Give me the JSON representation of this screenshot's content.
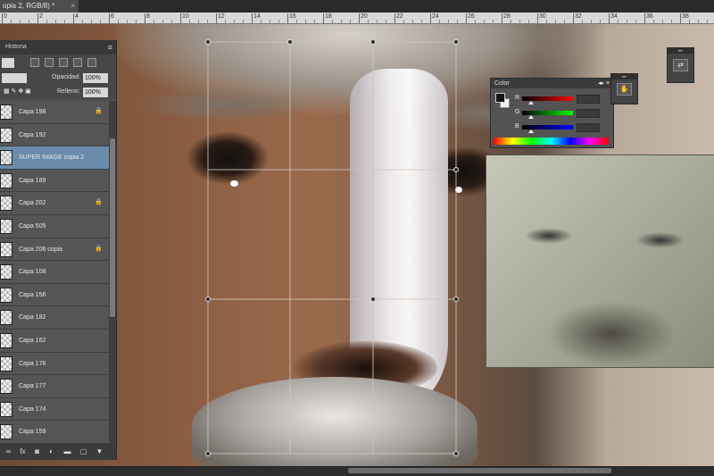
{
  "document_tab": {
    "label": "opia 2, RGB/8) *",
    "close": "×"
  },
  "ruler": {
    "labels": [
      "0",
      "2",
      "4",
      "6",
      "8",
      "10",
      "12",
      "14",
      "16",
      "18",
      "20",
      "22",
      "24",
      "26",
      "28",
      "30",
      "32",
      "34",
      "36",
      "38",
      "40"
    ]
  },
  "layers_panel": {
    "title": "Historia",
    "menu_glyph": "≡",
    "opacity_label": "Opacidad:",
    "opacity_value": "100%",
    "fill_label": "Relleno:",
    "fill_value": "100%",
    "layers": [
      {
        "name": "Capa 198",
        "locked": true,
        "selected": false
      },
      {
        "name": "Capa 192",
        "locked": false,
        "selected": false
      },
      {
        "name": "SUPER IMAGE copia 2",
        "locked": false,
        "selected": true
      },
      {
        "name": "Capa 189",
        "locked": false,
        "selected": false
      },
      {
        "name": "Capa 202",
        "locked": true,
        "selected": false
      },
      {
        "name": "Capa 505",
        "locked": false,
        "selected": false
      },
      {
        "name": "Capa 206 copia",
        "locked": true,
        "selected": false
      },
      {
        "name": "Capa 108",
        "locked": false,
        "selected": false
      },
      {
        "name": "Capa 156",
        "locked": false,
        "selected": false
      },
      {
        "name": "Capa 182",
        "locked": false,
        "selected": false
      },
      {
        "name": "Capa 162",
        "locked": false,
        "selected": false
      },
      {
        "name": "Capa 176",
        "locked": false,
        "selected": false
      },
      {
        "name": "Capa 177",
        "locked": false,
        "selected": false
      },
      {
        "name": "Capa 174",
        "locked": false,
        "selected": false
      },
      {
        "name": "Capa 159",
        "locked": false,
        "selected": false
      }
    ],
    "footer_icons": [
      "link-icon",
      "fx-icon",
      "mask-icon",
      "adjustment-icon",
      "folder-icon",
      "new-layer-icon",
      "trash-icon"
    ]
  },
  "color_panel": {
    "title": "Color",
    "controls": "◂▸ ≡",
    "channels": [
      {
        "label": "R",
        "gradient": "linear-gradient(90deg,#000,#f00)"
      },
      {
        "label": "G",
        "gradient": "linear-gradient(90deg,#000,#0f0)"
      },
      {
        "label": "B",
        "gradient": "linear-gradient(90deg,#000,#00f)"
      }
    ],
    "foreground": "#151515",
    "background": "#f2f2f2"
  },
  "dock": {
    "button_a": "⇄",
    "button_b": "✋",
    "collapse": "▸▸"
  }
}
